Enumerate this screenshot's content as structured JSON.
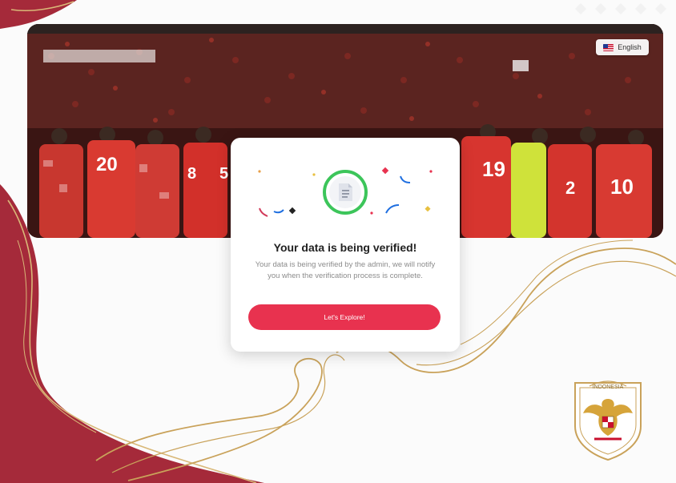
{
  "header": {
    "language_button": {
      "label": "English",
      "flag_icon": "us-flag-icon"
    }
  },
  "verification_card": {
    "status_icon": "document-icon",
    "title": "Your data is being verified!",
    "description": "Your data is being verified by the admin, we will notify you when the verification process is complete.",
    "button_label": "Let's Explore!"
  },
  "hero": {
    "jersey_numbers": [
      "20",
      "8",
      "5",
      "19",
      "2",
      "10"
    ]
  },
  "emblem": {
    "text": "INDONESIA"
  },
  "colors": {
    "accent": "#e8324f",
    "maroon": "#a52a3a",
    "gold": "#c9a25a",
    "success_ring": "#3cc55a"
  }
}
